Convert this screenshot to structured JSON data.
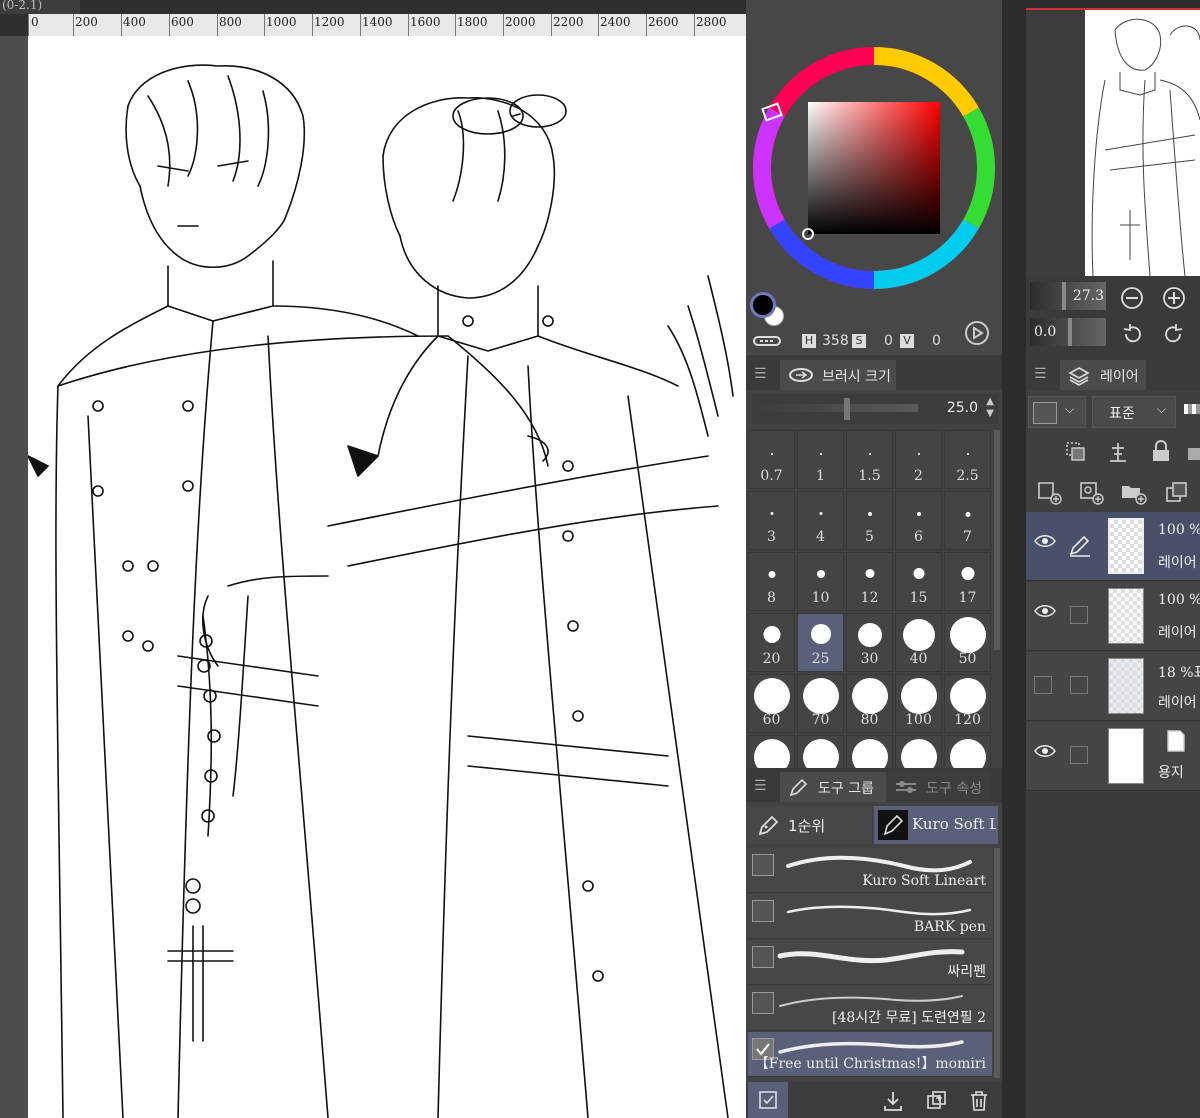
{
  "document": {
    "tab_title": "(0-2.1)"
  },
  "ruler": {
    "ticks": [
      "0",
      "200",
      "400",
      "600",
      "800",
      "1000",
      "1200",
      "1400",
      "1600",
      "1800",
      "2000",
      "2200",
      "2400",
      "2600",
      "2800"
    ]
  },
  "color": {
    "h_label": "H",
    "h_value": "358",
    "s_label": "S",
    "s_value": "0",
    "v_label": "V",
    "v_value": "0",
    "main_color": "#000000",
    "sub_color": "#ffffff"
  },
  "brush_size_panel": {
    "tab_label": "브러시 크기",
    "size_value": "25.0",
    "sizes": [
      "0.7",
      "1",
      "1.5",
      "2",
      "2.5",
      "3",
      "4",
      "5",
      "6",
      "7",
      "8",
      "10",
      "12",
      "15",
      "17",
      "20",
      "25",
      "30",
      "40",
      "50",
      "60",
      "70",
      "80",
      "100",
      "120"
    ],
    "selected": "25"
  },
  "tool_panel": {
    "tab_group": "도구 그룹",
    "tab_property": "도구 속성",
    "group_tab_1": "1순위",
    "group_tab_2": "Kuro Soft Li",
    "tools": [
      {
        "name": "Kuro Soft Lineart",
        "checked": false
      },
      {
        "name": "BARK pen",
        "checked": false
      },
      {
        "name": "싸리펜",
        "checked": false
      },
      {
        "name": "[48시간 무료] 도련연필 2",
        "checked": false
      },
      {
        "name": "【Free until Christmas!】momiri",
        "checked": true
      }
    ]
  },
  "navigator": {
    "zoom_value": "27.3",
    "rotation_value": "0.0"
  },
  "layer_panel": {
    "tab_label": "레이어",
    "blend_mode": "표준",
    "layers": [
      {
        "opacity": "100 %",
        "name": "레이어",
        "visible": true,
        "selected": true
      },
      {
        "opacity": "100 %",
        "name": "레이어",
        "visible": true,
        "selected": false
      },
      {
        "opacity": "18 %표",
        "name": "레이어",
        "visible": false,
        "selected": false
      },
      {
        "opacity": "",
        "name": "용지",
        "visible": true,
        "selected": false
      }
    ]
  }
}
